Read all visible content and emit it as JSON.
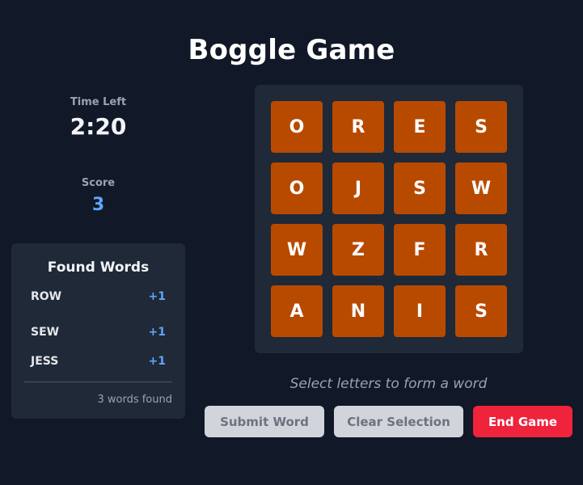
{
  "title": "Boggle Game",
  "stats": {
    "time_label": "Time Left",
    "time_value": "2:20",
    "score_label": "Score",
    "score_value": "3"
  },
  "found_words": {
    "title": "Found Words",
    "items": [
      {
        "word": "ROW",
        "points": "+1"
      },
      {
        "word": "SEW",
        "points": "+1"
      },
      {
        "word": "JESS",
        "points": "+1"
      }
    ],
    "summary": "3 words found"
  },
  "board": {
    "rows": [
      [
        "O",
        "R",
        "E",
        "S"
      ],
      [
        "O",
        "J",
        "S",
        "W"
      ],
      [
        "W",
        "Z",
        "F",
        "R"
      ],
      [
        "A",
        "N",
        "I",
        "S"
      ]
    ]
  },
  "hint": "Select letters to form a word",
  "buttons": {
    "submit": "Submit Word",
    "clear": "Clear Selection",
    "end": "End Game"
  },
  "colors": {
    "background": "#111827",
    "panel": "#1f2937",
    "tile": "#b84a00",
    "accent_blue": "#60a5fa",
    "end_button": "#ef233c",
    "disabled_button": "#d1d5db"
  }
}
